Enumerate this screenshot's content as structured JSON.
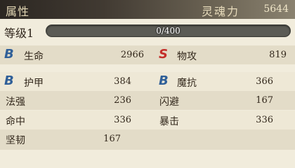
{
  "header": {
    "title": "属性",
    "soul_label": "灵魂力",
    "soul_value": "5644"
  },
  "level": {
    "label": "等级1",
    "progress_text": "0/400",
    "progress_fraction": 0
  },
  "stats": {
    "hp": {
      "label": "生命",
      "value": "2966",
      "grade": "B"
    },
    "patk": {
      "label": "物攻",
      "value": "819",
      "grade": "S"
    },
    "armor": {
      "label": "护甲",
      "value": "384",
      "grade": "B"
    },
    "mres": {
      "label": "魔抗",
      "value": "366",
      "grade": "B"
    },
    "spell": {
      "label": "法强",
      "value": "236"
    },
    "dodge": {
      "label": "闪避",
      "value": "167"
    },
    "hit": {
      "label": "命中",
      "value": "336"
    },
    "crit": {
      "label": "暴击",
      "value": "336"
    },
    "tough": {
      "label": "坚韧",
      "value": "167"
    }
  },
  "colors": {
    "grade_b": "#2f5f98",
    "grade_s": "#c42e2a",
    "bar_fill": "#c9a548"
  }
}
